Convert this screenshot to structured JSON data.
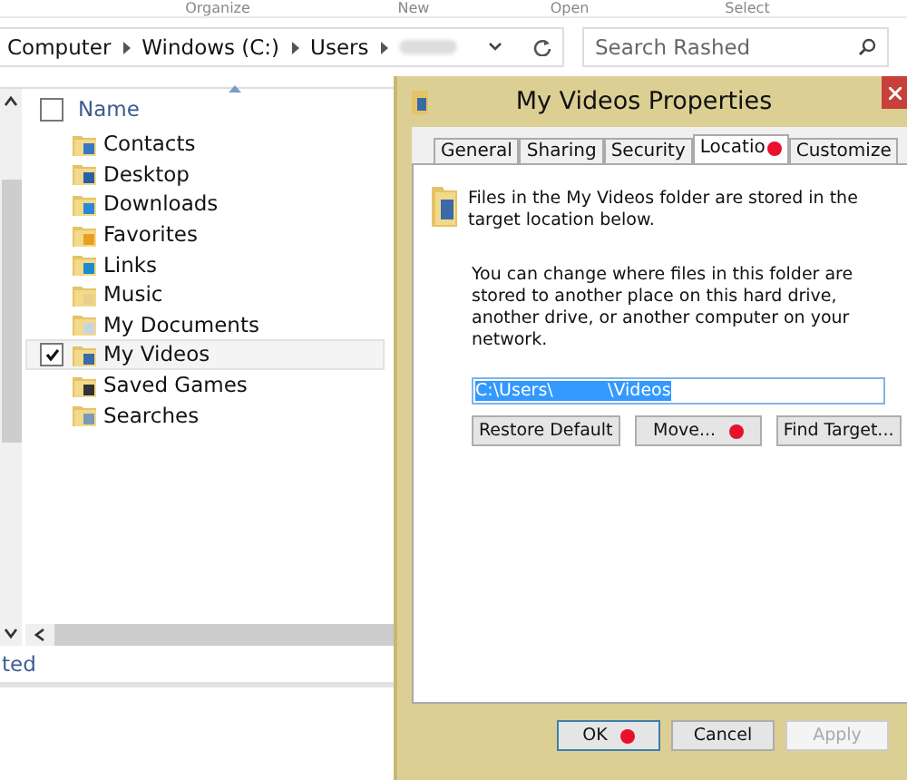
{
  "ribbon_groups": [
    "Organize",
    "New",
    "Open",
    "Select"
  ],
  "address_bar": {
    "crumbs": [
      "Computer",
      "Windows (C:)",
      "Users"
    ]
  },
  "search": {
    "placeholder": "Search Rashed"
  },
  "file_list": {
    "column": "Name",
    "all_checked": false,
    "items": [
      {
        "name": "Contacts",
        "kind": "contacts",
        "checked": false
      },
      {
        "name": "Desktop",
        "kind": "desktop",
        "checked": false
      },
      {
        "name": "Downloads",
        "kind": "downloads",
        "checked": false
      },
      {
        "name": "Favorites",
        "kind": "favorites",
        "checked": false
      },
      {
        "name": "Links",
        "kind": "links",
        "checked": false
      },
      {
        "name": "Music",
        "kind": "music",
        "checked": false
      },
      {
        "name": "My Documents",
        "kind": "documents",
        "checked": false
      },
      {
        "name": "My Videos",
        "kind": "videos",
        "checked": true
      },
      {
        "name": "Saved Games",
        "kind": "games",
        "checked": false
      },
      {
        "name": "Searches",
        "kind": "searches",
        "checked": false
      }
    ]
  },
  "status_bar": {
    "text": "ted"
  },
  "dialog": {
    "title": "My Videos Properties",
    "tabs": [
      {
        "label": "General",
        "selected": false,
        "marked": false
      },
      {
        "label": "Sharing",
        "selected": false,
        "marked": false
      },
      {
        "label": "Security",
        "selected": false,
        "marked": false
      },
      {
        "label": "Locatio",
        "selected": true,
        "marked": true
      },
      {
        "label": "Customize",
        "selected": false,
        "marked": false
      }
    ],
    "intro": "Files in the My Videos folder are stored in the target location below.",
    "info": "You can change where files in this folder are stored to another place on this hard drive, another drive, or another computer on your network.",
    "path": {
      "value": "C:\\Users\\          \\Videos"
    },
    "buttons": [
      {
        "label": "Restore Default",
        "marked": false,
        "disabled": false
      },
      {
        "label": "Move...",
        "marked": true,
        "disabled": false
      },
      {
        "label": "Find Target...",
        "marked": false,
        "disabled": false
      }
    ],
    "footer_buttons": [
      {
        "label": "OK",
        "marked": true,
        "disabled": false,
        "default": true
      },
      {
        "label": "Cancel",
        "marked": false,
        "disabled": false,
        "default": false
      },
      {
        "label": "Apply",
        "marked": false,
        "disabled": true,
        "default": false
      }
    ]
  }
}
